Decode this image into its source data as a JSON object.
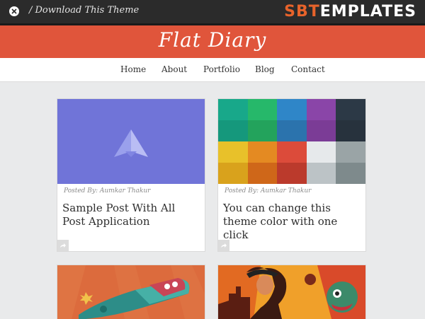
{
  "topbar": {
    "download_text": "/ Download This Theme",
    "brand_part1": "SBT",
    "brand_part2": "EMPLATES"
  },
  "header": {
    "site_title": "Flat Diary"
  },
  "nav": {
    "items": [
      {
        "label": "Home"
      },
      {
        "label": "About"
      },
      {
        "label": "Portfolio"
      },
      {
        "label": "Blog"
      },
      {
        "label": "Contact"
      }
    ]
  },
  "posts": [
    {
      "author_line": "Posted By: Aumkar Thakur",
      "title": "Sample Post With All Post Application"
    },
    {
      "author_line": "Posted By: Aumkar Thakur",
      "title": "You can change this theme color with one click"
    }
  ],
  "colors": {
    "header_bg": "#e0553b",
    "topbar_bg": "#2b2b2b",
    "brand_accent": "#e7632b",
    "thumb1_bg": "#7074d8"
  },
  "icons": {
    "close": "close-icon",
    "share": "share-icon",
    "paper_plane": "paper-plane-icon"
  }
}
